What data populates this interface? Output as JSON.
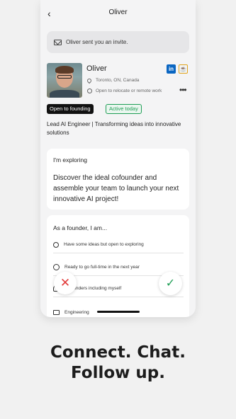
{
  "header": {
    "back_glyph": "‹",
    "title": "Oliver"
  },
  "invite": {
    "icon": "envelope-icon",
    "text": "Oliver sent you an invite."
  },
  "profile": {
    "name": "Oliver",
    "location": "Toronto, ON, Canada",
    "relocation": "Open to relocate or remote work",
    "linkedin_label": "in",
    "more_glyph": "•••",
    "badges": {
      "founding": "Open to founding",
      "active": "Active today"
    },
    "headline": "Lead AI Engineer | Transforming ideas into innovative solutions"
  },
  "exploring": {
    "label": "I'm exploring",
    "text": "Discover the ideal cofounder and assemble your team to launch your next innovative AI project!"
  },
  "founder": {
    "label": "As a founder, I am...",
    "rows": [
      {
        "icon": "search-icon",
        "text": "Have some ideas but open to exploring"
      },
      {
        "icon": "timer-icon",
        "text": "Ready to go full-time in the next year"
      },
      {
        "icon": "people-icon",
        "text": "cofounders including myself"
      },
      {
        "icon": "briefcase-icon",
        "text": "Engineering"
      }
    ]
  },
  "actions": {
    "reject_glyph": "✕",
    "accept_glyph": "✓"
  },
  "tagline": {
    "line1": "Connect. Chat.",
    "line2": "Follow up."
  },
  "colors": {
    "accent_green": "#1f9e55",
    "reject_red": "#e23b3b",
    "linkedin_blue": "#0a66c2"
  }
}
